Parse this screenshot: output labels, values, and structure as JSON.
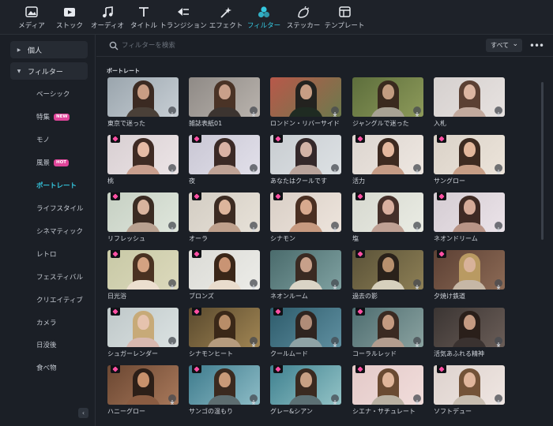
{
  "toolbar": {
    "items": [
      {
        "label": "メディア",
        "icon": "media-icon"
      },
      {
        "label": "ストック",
        "icon": "stock-icon"
      },
      {
        "label": "オーディオ",
        "icon": "music-note-icon"
      },
      {
        "label": "タイトル",
        "icon": "text-icon"
      },
      {
        "label": "トランジション",
        "icon": "transition-icon"
      },
      {
        "label": "エフェクト",
        "icon": "sparkle-icon"
      },
      {
        "label": "フィルター",
        "icon": "filter-icon"
      },
      {
        "label": "ステッカー",
        "icon": "sticker-icon"
      },
      {
        "label": "テンプレート",
        "icon": "template-icon"
      }
    ],
    "active_index": 6
  },
  "sidebar": {
    "personal": "個人",
    "filters": "フィルター",
    "items": [
      {
        "label": "ベーシック"
      },
      {
        "label": "特集",
        "badge": "NEW"
      },
      {
        "label": "モノ"
      },
      {
        "label": "風景",
        "badge": "HOT"
      },
      {
        "label": "ポートレート"
      },
      {
        "label": "ライフスタイル"
      },
      {
        "label": "シネマティック"
      },
      {
        "label": "レトロ"
      },
      {
        "label": "フェスティバル"
      },
      {
        "label": "クリエイティブ"
      },
      {
        "label": "カメラ"
      },
      {
        "label": "日没後"
      },
      {
        "label": "食べ物"
      }
    ],
    "active_index": 4,
    "collapse_glyph": "‹"
  },
  "search": {
    "placeholder": "フィルターを検索",
    "value": ""
  },
  "sort": {
    "label": "すべて",
    "chevron": "⌄"
  },
  "more_glyph": "•••",
  "section_title": "ポートレート",
  "colors": {
    "accent": "#35c8e0",
    "new_badge": "#e0459a",
    "hot_badge": "#e0459a",
    "premium_gem": "#ff4fa3"
  },
  "filters": [
    {
      "name": "東京で迷った",
      "premium": false,
      "bg": "#9aa5ad",
      "bg2": "#c7ced4",
      "hair": "#3b2a22",
      "skin": "#c99d84",
      "cloth": "#4a4038"
    },
    {
      "name": "雑誌表紙01",
      "premium": false,
      "bg": "#8f8a86",
      "bg2": "#b9b3ad",
      "hair": "#4a3326",
      "skin": "#c9a08a",
      "cloth": "#3c3430"
    },
    {
      "name": "ロンドン・リバーサイド",
      "premium": false,
      "bg": "#b8584a",
      "bg2": "#6c7a4c",
      "hair": "#23221f",
      "skin": "#c79d84",
      "cloth": "#1f2b22"
    },
    {
      "name": "ジャングルで迷った",
      "premium": false,
      "bg": "#5d6e3c",
      "bg2": "#8d9a5a",
      "hair": "#3a2a1e",
      "skin": "#c29c80",
      "cloth": "#a8a294"
    },
    {
      "name": "入札",
      "premium": false,
      "bg": "#d5d0ce",
      "bg2": "#e7e2e0",
      "hair": "#5b4033",
      "skin": "#dcb6a2",
      "cloth": "#c2aa9e"
    },
    {
      "name": "桃",
      "premium": true,
      "bg": "#d8cfd2",
      "bg2": "#ece4e6",
      "hair": "#3f2b24",
      "skin": "#e6bba6",
      "cloth": "#c99f8e"
    },
    {
      "name": "夜",
      "premium": true,
      "bg": "#c9c7d4",
      "bg2": "#e2e0ea",
      "hair": "#3b2a26",
      "skin": "#d9b2a4",
      "cloth": "#bfa396"
    },
    {
      "name": "あなたはクールです",
      "premium": true,
      "bg": "#c8cdd1",
      "bg2": "#dde1e4",
      "hair": "#34282a",
      "skin": "#d3b3a6",
      "cloth": "#b9a49c"
    },
    {
      "name": "活力",
      "premium": true,
      "bg": "#dcd5cf",
      "bg2": "#eee7e1",
      "hair": "#3d2a20",
      "skin": "#e4b89e",
      "cloth": "#c59c86"
    },
    {
      "name": "サングロー",
      "premium": true,
      "bg": "#dad2c8",
      "bg2": "#ece4da",
      "hair": "#3d2b21",
      "skin": "#e2b79c",
      "cloth": "#c69e86"
    },
    {
      "name": "リフレッシュ",
      "premium": true,
      "bg": "#c6d0c3",
      "bg2": "#dfe6dc",
      "hair": "#3a2b22",
      "skin": "#d8b49e",
      "cloth": "#b8a190"
    },
    {
      "name": "オーラ",
      "premium": true,
      "bg": "#d3cdc3",
      "bg2": "#e7e1d8",
      "hair": "#3c2b22",
      "skin": "#dcb59c",
      "cloth": "#bea08c"
    },
    {
      "name": "シナモン",
      "premium": true,
      "bg": "#d9cfc6",
      "bg2": "#ede4dc",
      "hair": "#4a2f22",
      "skin": "#d8a98e",
      "cloth": "#c79a80"
    },
    {
      "name": "塩",
      "premium": true,
      "bg": "#d6d8cf",
      "bg2": "#eaece4",
      "hair": "#45302a",
      "skin": "#d9b0a0",
      "cloth": "#bfa194"
    },
    {
      "name": "ネオンドリーム",
      "premium": true,
      "bg": "#d4ccd2",
      "bg2": "#ebe3e9",
      "hair": "#3f2a24",
      "skin": "#d7ab98",
      "cloth": "#b89486"
    },
    {
      "name": "日光浴",
      "premium": true,
      "bg": "#c8c9a6",
      "bg2": "#dcd9bc",
      "hair": "#4a3222",
      "skin": "#d4a281",
      "cloth": "#ecdfcf"
    },
    {
      "name": "ブロンズ",
      "premium": true,
      "bg": "#dbdbd6",
      "bg2": "#ecece8",
      "hair": "#3a2618",
      "skin": "#c99474",
      "cloth": "#e9dccd"
    },
    {
      "name": "ネオンルーム",
      "premium": false,
      "bg": "#4a6b6c",
      "bg2": "#7fa1a1",
      "hair": "#3a2a22",
      "skin": "#c7a08a",
      "cloth": "#dad4c6"
    },
    {
      "name": "過去の影",
      "premium": true,
      "bg": "#5a5238",
      "bg2": "#8d7f55",
      "hair": "#2a211a",
      "skin": "#b8906e",
      "cloth": "#d6d0bd"
    },
    {
      "name": "夕焼け鉄道",
      "premium": true,
      "bg": "#5c4034",
      "bg2": "#8c6a55",
      "hair": "#b99a62",
      "skin": "#d8b29a",
      "cloth": "#c6b7a6"
    },
    {
      "name": "シュガーレンダー",
      "premium": true,
      "bg": "#bfc8c9",
      "bg2": "#dbe2e2",
      "hair": "#c7aa78",
      "skin": "#e6c3ae",
      "cloth": "#d8b9b0"
    },
    {
      "name": "シナモンヒート",
      "premium": true,
      "bg": "#5a4a2e",
      "bg2": "#a08553",
      "hair": "#3a2818",
      "skin": "#b88d68",
      "cloth": "#b59b7e"
    },
    {
      "name": "クールムード",
      "premium": true,
      "bg": "#2e5c6c",
      "bg2": "#5f8fa0",
      "hair": "#2e2420",
      "skin": "#b08c78",
      "cloth": "#8fa3a6"
    },
    {
      "name": "コーラルレッド",
      "premium": true,
      "bg": "#4e6d70",
      "bg2": "#8aa2a0",
      "hair": "#3a2a22",
      "skin": "#c49a80",
      "cloth": "#b39d8f"
    },
    {
      "name": "活気あふれる精神",
      "premium": false,
      "bg": "#3b3533",
      "bg2": "#6a5d57",
      "hair": "#2a1f1a",
      "skin": "#c49a82",
      "cloth": "#3a3230"
    },
    {
      "name": "ハニーグロー",
      "premium": true,
      "bg": "#6b4732",
      "bg2": "#a8785a",
      "hair": "#2c1f18",
      "skin": "#c8916c",
      "cloth": "#8a5c42"
    },
    {
      "name": "サンゴの温もり",
      "premium": true,
      "bg": "#3e7b8d",
      "bg2": "#8dbcc6",
      "hair": "#3b2a1f",
      "skin": "#c99a78",
      "cloth": "#5d6d70"
    },
    {
      "name": "グレー&シアン",
      "premium": true,
      "bg": "#3f8190",
      "bg2": "#93c3c6",
      "hair": "#3a2a20",
      "skin": "#c8a084",
      "cloth": "#5c7074"
    },
    {
      "name": "シエナ・サチュレート",
      "premium": true,
      "bg": "#e3c9c8",
      "bg2": "#f1dddb",
      "hair": "#6a4a32",
      "skin": "#e0b59a",
      "cloth": "#b9b0a2"
    },
    {
      "name": "ソフトデュー",
      "premium": true,
      "bg": "#ddd2cd",
      "bg2": "#efe6e2",
      "hair": "#735338",
      "skin": "#e0b69c",
      "cloth": "#c7bdb0"
    }
  ]
}
